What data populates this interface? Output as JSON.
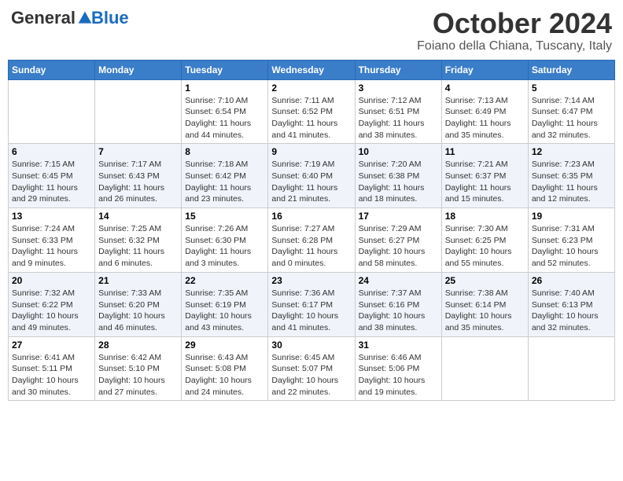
{
  "header": {
    "logo_general": "General",
    "logo_blue": "Blue",
    "month": "October 2024",
    "location": "Foiano della Chiana, Tuscany, Italy"
  },
  "weekdays": [
    "Sunday",
    "Monday",
    "Tuesday",
    "Wednesday",
    "Thursday",
    "Friday",
    "Saturday"
  ],
  "weeks": [
    [
      {
        "day": "",
        "sunrise": "",
        "sunset": "",
        "daylight": ""
      },
      {
        "day": "",
        "sunrise": "",
        "sunset": "",
        "daylight": ""
      },
      {
        "day": "1",
        "sunrise": "Sunrise: 7:10 AM",
        "sunset": "Sunset: 6:54 PM",
        "daylight": "Daylight: 11 hours and 44 minutes."
      },
      {
        "day": "2",
        "sunrise": "Sunrise: 7:11 AM",
        "sunset": "Sunset: 6:52 PM",
        "daylight": "Daylight: 11 hours and 41 minutes."
      },
      {
        "day": "3",
        "sunrise": "Sunrise: 7:12 AM",
        "sunset": "Sunset: 6:51 PM",
        "daylight": "Daylight: 11 hours and 38 minutes."
      },
      {
        "day": "4",
        "sunrise": "Sunrise: 7:13 AM",
        "sunset": "Sunset: 6:49 PM",
        "daylight": "Daylight: 11 hours and 35 minutes."
      },
      {
        "day": "5",
        "sunrise": "Sunrise: 7:14 AM",
        "sunset": "Sunset: 6:47 PM",
        "daylight": "Daylight: 11 hours and 32 minutes."
      }
    ],
    [
      {
        "day": "6",
        "sunrise": "Sunrise: 7:15 AM",
        "sunset": "Sunset: 6:45 PM",
        "daylight": "Daylight: 11 hours and 29 minutes."
      },
      {
        "day": "7",
        "sunrise": "Sunrise: 7:17 AM",
        "sunset": "Sunset: 6:43 PM",
        "daylight": "Daylight: 11 hours and 26 minutes."
      },
      {
        "day": "8",
        "sunrise": "Sunrise: 7:18 AM",
        "sunset": "Sunset: 6:42 PM",
        "daylight": "Daylight: 11 hours and 23 minutes."
      },
      {
        "day": "9",
        "sunrise": "Sunrise: 7:19 AM",
        "sunset": "Sunset: 6:40 PM",
        "daylight": "Daylight: 11 hours and 21 minutes."
      },
      {
        "day": "10",
        "sunrise": "Sunrise: 7:20 AM",
        "sunset": "Sunset: 6:38 PM",
        "daylight": "Daylight: 11 hours and 18 minutes."
      },
      {
        "day": "11",
        "sunrise": "Sunrise: 7:21 AM",
        "sunset": "Sunset: 6:37 PM",
        "daylight": "Daylight: 11 hours and 15 minutes."
      },
      {
        "day": "12",
        "sunrise": "Sunrise: 7:23 AM",
        "sunset": "Sunset: 6:35 PM",
        "daylight": "Daylight: 11 hours and 12 minutes."
      }
    ],
    [
      {
        "day": "13",
        "sunrise": "Sunrise: 7:24 AM",
        "sunset": "Sunset: 6:33 PM",
        "daylight": "Daylight: 11 hours and 9 minutes."
      },
      {
        "day": "14",
        "sunrise": "Sunrise: 7:25 AM",
        "sunset": "Sunset: 6:32 PM",
        "daylight": "Daylight: 11 hours and 6 minutes."
      },
      {
        "day": "15",
        "sunrise": "Sunrise: 7:26 AM",
        "sunset": "Sunset: 6:30 PM",
        "daylight": "Daylight: 11 hours and 3 minutes."
      },
      {
        "day": "16",
        "sunrise": "Sunrise: 7:27 AM",
        "sunset": "Sunset: 6:28 PM",
        "daylight": "Daylight: 11 hours and 0 minutes."
      },
      {
        "day": "17",
        "sunrise": "Sunrise: 7:29 AM",
        "sunset": "Sunset: 6:27 PM",
        "daylight": "Daylight: 10 hours and 58 minutes."
      },
      {
        "day": "18",
        "sunrise": "Sunrise: 7:30 AM",
        "sunset": "Sunset: 6:25 PM",
        "daylight": "Daylight: 10 hours and 55 minutes."
      },
      {
        "day": "19",
        "sunrise": "Sunrise: 7:31 AM",
        "sunset": "Sunset: 6:23 PM",
        "daylight": "Daylight: 10 hours and 52 minutes."
      }
    ],
    [
      {
        "day": "20",
        "sunrise": "Sunrise: 7:32 AM",
        "sunset": "Sunset: 6:22 PM",
        "daylight": "Daylight: 10 hours and 49 minutes."
      },
      {
        "day": "21",
        "sunrise": "Sunrise: 7:33 AM",
        "sunset": "Sunset: 6:20 PM",
        "daylight": "Daylight: 10 hours and 46 minutes."
      },
      {
        "day": "22",
        "sunrise": "Sunrise: 7:35 AM",
        "sunset": "Sunset: 6:19 PM",
        "daylight": "Daylight: 10 hours and 43 minutes."
      },
      {
        "day": "23",
        "sunrise": "Sunrise: 7:36 AM",
        "sunset": "Sunset: 6:17 PM",
        "daylight": "Daylight: 10 hours and 41 minutes."
      },
      {
        "day": "24",
        "sunrise": "Sunrise: 7:37 AM",
        "sunset": "Sunset: 6:16 PM",
        "daylight": "Daylight: 10 hours and 38 minutes."
      },
      {
        "day": "25",
        "sunrise": "Sunrise: 7:38 AM",
        "sunset": "Sunset: 6:14 PM",
        "daylight": "Daylight: 10 hours and 35 minutes."
      },
      {
        "day": "26",
        "sunrise": "Sunrise: 7:40 AM",
        "sunset": "Sunset: 6:13 PM",
        "daylight": "Daylight: 10 hours and 32 minutes."
      }
    ],
    [
      {
        "day": "27",
        "sunrise": "Sunrise: 6:41 AM",
        "sunset": "Sunset: 5:11 PM",
        "daylight": "Daylight: 10 hours and 30 minutes."
      },
      {
        "day": "28",
        "sunrise": "Sunrise: 6:42 AM",
        "sunset": "Sunset: 5:10 PM",
        "daylight": "Daylight: 10 hours and 27 minutes."
      },
      {
        "day": "29",
        "sunrise": "Sunrise: 6:43 AM",
        "sunset": "Sunset: 5:08 PM",
        "daylight": "Daylight: 10 hours and 24 minutes."
      },
      {
        "day": "30",
        "sunrise": "Sunrise: 6:45 AM",
        "sunset": "Sunset: 5:07 PM",
        "daylight": "Daylight: 10 hours and 22 minutes."
      },
      {
        "day": "31",
        "sunrise": "Sunrise: 6:46 AM",
        "sunset": "Sunset: 5:06 PM",
        "daylight": "Daylight: 10 hours and 19 minutes."
      },
      {
        "day": "",
        "sunrise": "",
        "sunset": "",
        "daylight": ""
      },
      {
        "day": "",
        "sunrise": "",
        "sunset": "",
        "daylight": ""
      }
    ]
  ]
}
